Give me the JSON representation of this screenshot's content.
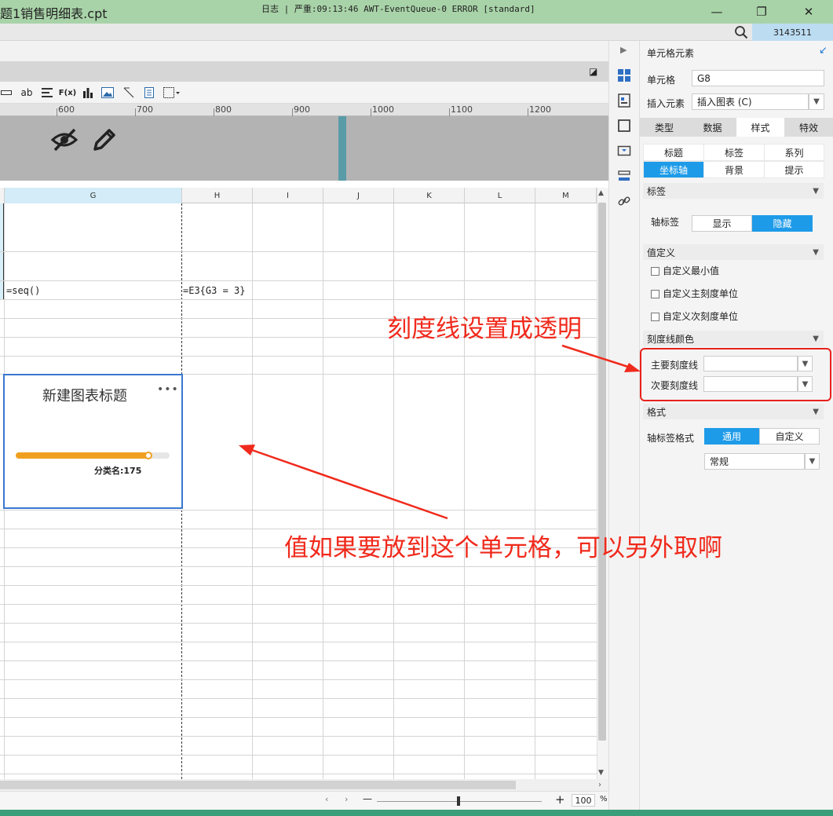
{
  "window": {
    "title": "题1销售明细表.cpt",
    "minimize": "—",
    "maximize": "❐",
    "close": "✕"
  },
  "logbar": {
    "text": "日志 | 严重:09:13:46 AWT-EventQueue-0 ERROR [standard]",
    "user_id": "3143511"
  },
  "toolbar": {
    "items": [
      "ab",
      "F(x)"
    ]
  },
  "ruler": {
    "labels": [
      "600",
      "700",
      "800",
      "900",
      "1000",
      "1100",
      "1200"
    ]
  },
  "grid": {
    "columns": [
      "G",
      "H",
      "I",
      "J",
      "K",
      "L",
      "M"
    ],
    "cell_g3": "=seq()",
    "cell_h3": "=E3{G3 = 3}"
  },
  "chart": {
    "title": "新建图表标题",
    "more": "•••",
    "label": "分类名:175",
    "value": 175,
    "fill_fraction": 0.86,
    "fill_color": "#f0a020"
  },
  "statusbar": {
    "minus": "—",
    "plus": "+",
    "zoom": "100",
    "percent": "%"
  },
  "panel": {
    "header": "单元格元素",
    "cell_label": "单元格",
    "cell_value": "G8",
    "insert_label": "插入元素",
    "insert_value": "插入图表 (C)",
    "tabs": [
      "类型",
      "数据",
      "样式",
      "特效"
    ],
    "subtabs": [
      "标题",
      "标签",
      "系列",
      "坐标轴",
      "背景",
      "提示"
    ],
    "section_label": "标签",
    "axis_label": "轴标签",
    "show": "显示",
    "hide": "隐藏",
    "section_custom": "值定义",
    "custom_min": "自定义最小值",
    "custom_major": "自定义主刻度单位",
    "custom_minor": "自定义次刻度单位",
    "section_color": "刻度线颜色",
    "major_line": "主要刻度线",
    "minor_line": "次要刻度线",
    "section_format": "格式",
    "format_label": "轴标签格式",
    "format_general": "通用",
    "format_custom": "自定义",
    "format_value": "常规"
  },
  "annotations": {
    "top": "刻度线设置成透明",
    "bottom": "值如果要放到这个单元格，可以另外取啊"
  },
  "colors": {
    "titlebar": "#a8d3a8",
    "accent": "#1e9be8",
    "annotation": "#f02a1c"
  }
}
